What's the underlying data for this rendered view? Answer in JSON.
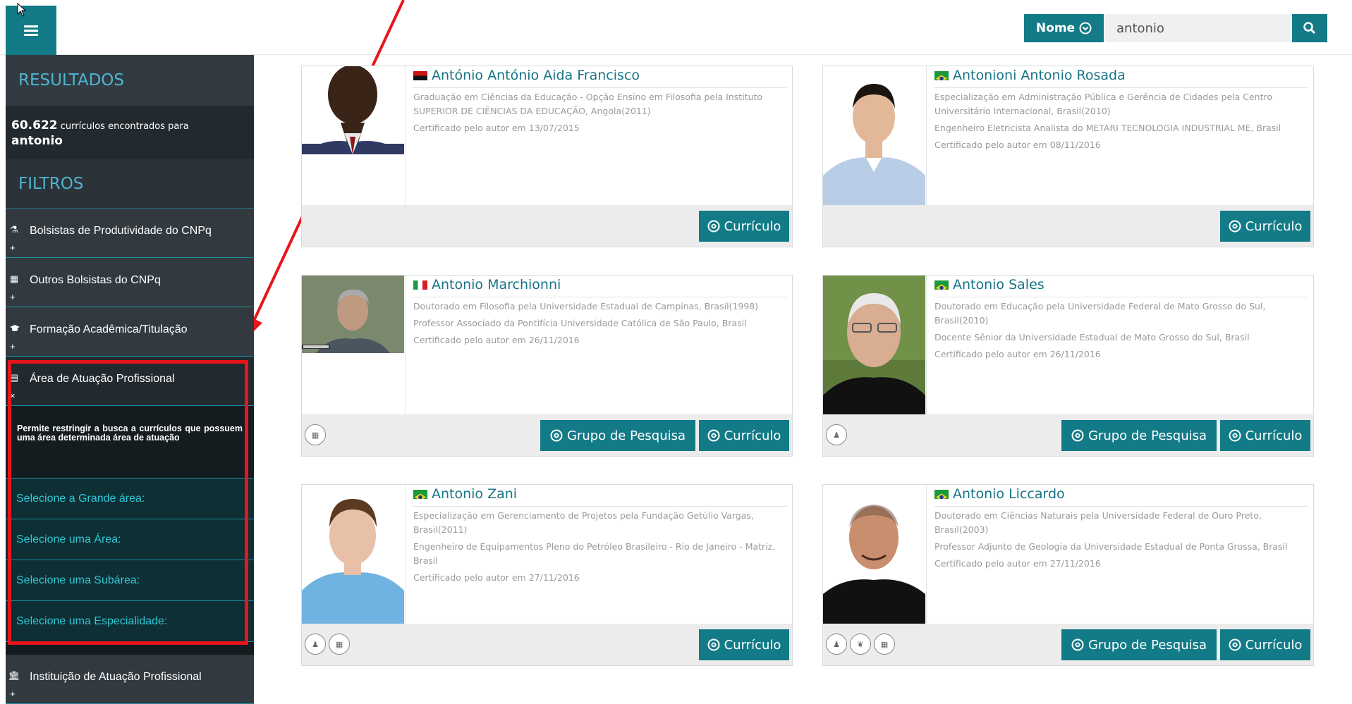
{
  "topbar": {
    "search_mode_label": "Nome",
    "search_value": "antonio"
  },
  "sidebar": {
    "results_heading": "RESULTADOS",
    "results_count": "60.622",
    "results_text": "currículos encontrados para",
    "results_query": "antonio",
    "filters_heading": "FILTROS",
    "filters": [
      {
        "label": "Bolsistas de Produtividade do CNPq",
        "toggle": "+"
      },
      {
        "label": "Outros Bolsistas do CNPq",
        "toggle": "+"
      },
      {
        "label": "Formação Acadêmica/Titulação",
        "toggle": "+"
      },
      {
        "label": "Área de Atuação Profissional",
        "toggle": "×"
      },
      {
        "label": "Instituição de Atuação Profissional",
        "toggle": "+"
      }
    ],
    "area_description": "Permite restringir a busca a currículos que possuem uma área determinada área de atuação",
    "area_selects": [
      "Selecione a Grande área:",
      "Selecione uma Área:",
      "Selecione uma Subárea:",
      "Selecione uma Especialidade:"
    ]
  },
  "buttons": {
    "curriculo": "Currículo",
    "grupo": "Grupo de Pesquisa"
  },
  "colors": {
    "accent": "#137b87",
    "sidebar_bg": "#2b3339",
    "highlight": "#e8151b"
  },
  "results": [
    {
      "name": "António António Aida Francisco",
      "flag": "angola",
      "lines": [
        "Graduação em Ciências da Educação - Opção Ensino em Filosofia pela Instituto SUPERIOR DE CIÊNCIAS DA EDUCAÇÃO, Angola(2011)",
        "Certificado pelo autor em 13/07/2015"
      ]
    },
    {
      "name": "Antonioni Antonio Rosada",
      "flag": "brazil",
      "lines": [
        "Especialização em Administração Pública e Gerência de Cidades pela Centro Universitário Internacional, Brasil(2010)",
        "Engenheiro Eletricista Analista do METARI TECNOLOGIA INDUSTRIAL ME, Brasil",
        "Certificado pelo autor em 08/11/2016"
      ]
    },
    {
      "name": "Antonio Marchionni",
      "flag": "italy",
      "lines": [
        "Doutorado em Filosofia pela Universidade Estadual de Campinas, Brasil(1998)",
        "Professor Associado da Pontifícia Universidade Católica de São Paulo, Brasil",
        "Certificado pelo autor em 26/11/2016"
      ]
    },
    {
      "name": "Antonio Sales",
      "flag": "brazil",
      "lines": [
        "Doutorado em Educação pela Universidade Federal de Mato Grosso do Sul, Brasil(2010)",
        "Docente Sênior da Universidade Estadual de Mato Grosso do Sul, Brasil",
        "Certificado pelo autor em 26/11/2016"
      ]
    },
    {
      "name": "Antonio Zani",
      "flag": "brazil",
      "lines": [
        "Especialização em Gerenciamento de Projetos pela Fundação Getúlio Vargas, Brasil(2011)",
        "Engenheiro de Equipamentos Pleno do Petróleo Brasileiro - Rio de Janeiro - Matriz, Brasil",
        "Certificado pelo autor em 27/11/2016"
      ]
    },
    {
      "name": "Antonio Liccardo",
      "flag": "brazil",
      "lines": [
        "Doutorado em Ciências Naturais pela Universidade Federal de Ouro Preto, Brasil(2003)",
        "Professor Adjunto de Geologia da Universidade Estadual de Ponta Grossa, Brasil",
        "Certificado pelo autor em 27/11/2016"
      ]
    }
  ]
}
